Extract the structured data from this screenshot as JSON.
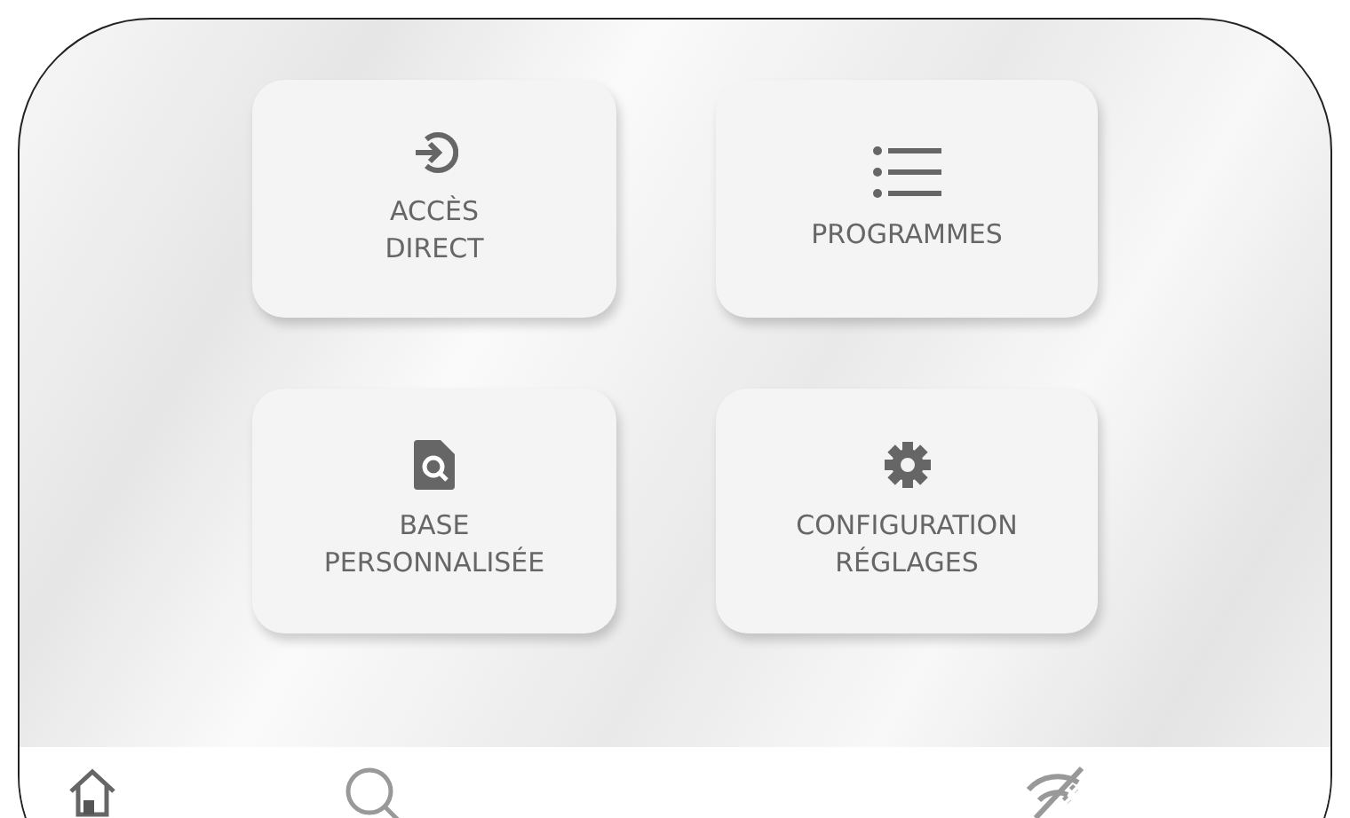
{
  "menu_cards": [
    {
      "kind": "enter",
      "label": "ACCÈS\nDIRECT"
    },
    {
      "kind": "list",
      "label": "PROGRAMMES"
    },
    {
      "kind": "file-search",
      "label": "BASE\nPERSONNALISÉE"
    },
    {
      "kind": "gear",
      "label": "CONFIGURATION\nRÉGLAGES"
    }
  ]
}
